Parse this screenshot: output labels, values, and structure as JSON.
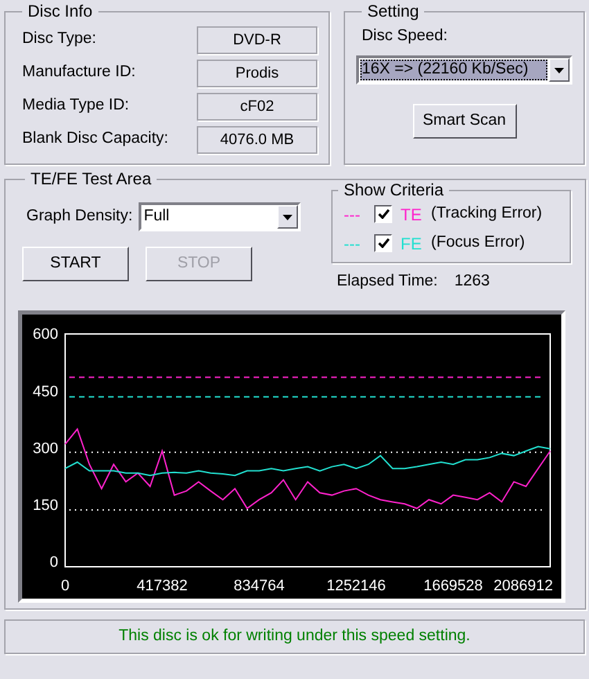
{
  "disc_info": {
    "title": "Disc Info",
    "fields": [
      {
        "label": "Disc Type:",
        "value": "DVD-R"
      },
      {
        "label": "Manufacture ID:",
        "value": "Prodis"
      },
      {
        "label": "Media Type ID:",
        "value": "cF02"
      },
      {
        "label": "Blank Disc Capacity:",
        "value": "4076.0 MB"
      }
    ]
  },
  "setting": {
    "title": "Setting",
    "speed_label": "Disc Speed:",
    "speed_value": "16X => (22160 Kb/Sec)",
    "smart_scan": "Smart Scan"
  },
  "test_area": {
    "title": "TE/FE Test Area",
    "density_label": "Graph Density:",
    "density_value": "Full",
    "buttons": [
      {
        "label": "START",
        "disabled": false
      },
      {
        "label": "STOP",
        "disabled": true
      }
    ],
    "criteria": {
      "title": "Show Criteria",
      "items": [
        {
          "marker": "---",
          "label": "(Tracking Error)",
          "checked": true,
          "color": "#ff22cc"
        },
        {
          "marker": "---",
          "label": "(Focus Error)",
          "checked": true,
          "color": "#22e0d0"
        }
      ]
    },
    "elapsed_label": "Elapsed Time:",
    "elapsed_value": "1263",
    "chart_data": {
      "type": "line",
      "x": [
        0,
        52173,
        104346,
        156519,
        208692,
        260865,
        313038,
        365211,
        417384,
        469557,
        521730,
        573903,
        626076,
        678249,
        730422,
        782595,
        834768,
        886941,
        939114,
        991287,
        1043460,
        1095633,
        1147806,
        1199979,
        1252152,
        1304325,
        1356498,
        1408671,
        1460844,
        1513017,
        1565190,
        1617363,
        1669536,
        1721709,
        1773882,
        1826055,
        1878228,
        1930401,
        1982574,
        2034747,
        2086920
      ],
      "series": [
        {
          "name": "TE",
          "color": "#ff22cc",
          "values": [
            323,
            363,
            270,
            206,
            270,
            224,
            247,
            212,
            305,
            189,
            200,
            224,
            200,
            177,
            206,
            154,
            177,
            195,
            229,
            177,
            224,
            195,
            189,
            200,
            206,
            189,
            177,
            171,
            166,
            154,
            177,
            166,
            189,
            183,
            177,
            195,
            171,
            224,
            212,
            259,
            305
          ]
        },
        {
          "name": "FE",
          "color": "#22e0d0",
          "values": [
            259,
            276,
            253,
            253,
            253,
            247,
            247,
            241,
            247,
            249,
            247,
            253,
            247,
            245,
            241,
            253,
            253,
            259,
            253,
            259,
            264,
            253,
            264,
            270,
            259,
            270,
            293,
            259,
            259,
            264,
            270,
            276,
            270,
            282,
            282,
            288,
            299,
            293,
            305,
            317,
            311
          ]
        }
      ],
      "xlim": [
        0,
        2086920
      ],
      "ylim": [
        0,
        614
      ],
      "xticks": [
        0,
        417382,
        834764,
        1252146,
        1669528,
        2086912
      ],
      "yticks": [
        0,
        150,
        300,
        450,
        600
      ],
      "ref_lines": [
        {
          "axis": "y",
          "value": 500,
          "color": "#ff22cc"
        },
        {
          "axis": "y",
          "value": 448,
          "color": "#22e0d0"
        },
        {
          "axis": "y",
          "value": 302,
          "color": "#ffffff"
        },
        {
          "axis": "y",
          "value": 150,
          "color": "#ffffff"
        }
      ]
    }
  },
  "status": "This disc is ok for writing under this speed setting."
}
